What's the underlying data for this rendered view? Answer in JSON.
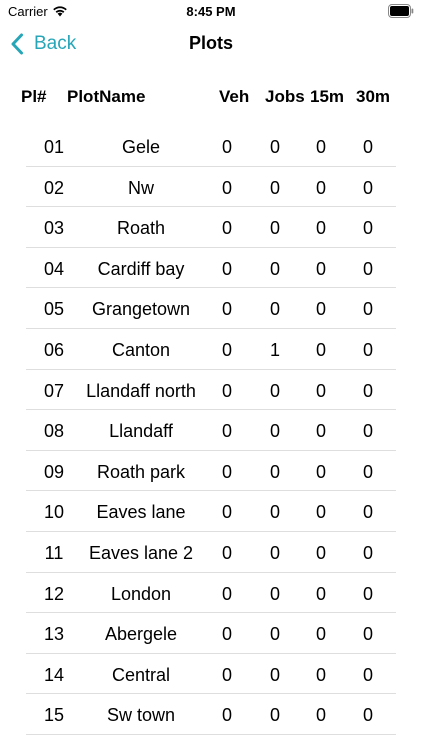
{
  "status_bar": {
    "carrier": "Carrier",
    "time": "8:45 PM"
  },
  "nav": {
    "back_label": "Back",
    "title": "Plots"
  },
  "columns": {
    "plot_number": "Pl#",
    "plot_name": "PlotName",
    "vehicles": "Veh",
    "jobs": "Jobs",
    "m15": "15m",
    "m30": "30m"
  },
  "plots": [
    {
      "num": "01",
      "name": "Gele",
      "veh": "0",
      "jobs": "0",
      "m15": "0",
      "m30": "0"
    },
    {
      "num": "02",
      "name": "Nw",
      "veh": "0",
      "jobs": "0",
      "m15": "0",
      "m30": "0"
    },
    {
      "num": "03",
      "name": "Roath",
      "veh": "0",
      "jobs": "0",
      "m15": "0",
      "m30": "0"
    },
    {
      "num": "04",
      "name": "Cardiff bay",
      "veh": "0",
      "jobs": "0",
      "m15": "0",
      "m30": "0"
    },
    {
      "num": "05",
      "name": "Grangetown",
      "veh": "0",
      "jobs": "0",
      "m15": "0",
      "m30": "0"
    },
    {
      "num": "06",
      "name": "Canton",
      "veh": "0",
      "jobs": "1",
      "m15": "0",
      "m30": "0"
    },
    {
      "num": "07",
      "name": "Llandaff north",
      "veh": "0",
      "jobs": "0",
      "m15": "0",
      "m30": "0"
    },
    {
      "num": "08",
      "name": "Llandaff",
      "veh": "0",
      "jobs": "0",
      "m15": "0",
      "m30": "0"
    },
    {
      "num": "09",
      "name": "Roath park",
      "veh": "0",
      "jobs": "0",
      "m15": "0",
      "m30": "0"
    },
    {
      "num": "10",
      "name": "Eaves lane",
      "veh": "0",
      "jobs": "0",
      "m15": "0",
      "m30": "0"
    },
    {
      "num": "11",
      "name": "Eaves lane 2",
      "veh": "0",
      "jobs": "0",
      "m15": "0",
      "m30": "0"
    },
    {
      "num": "12",
      "name": "London",
      "veh": "0",
      "jobs": "0",
      "m15": "0",
      "m30": "0"
    },
    {
      "num": "13",
      "name": "Abergele",
      "veh": "0",
      "jobs": "0",
      "m15": "0",
      "m30": "0"
    },
    {
      "num": "14",
      "name": "Central",
      "veh": "0",
      "jobs": "0",
      "m15": "0",
      "m30": "0"
    },
    {
      "num": "15",
      "name": "Sw town",
      "veh": "0",
      "jobs": "0",
      "m15": "0",
      "m30": "0"
    }
  ],
  "colors": {
    "accent": "#27a6b8",
    "separator": "#dedede"
  }
}
